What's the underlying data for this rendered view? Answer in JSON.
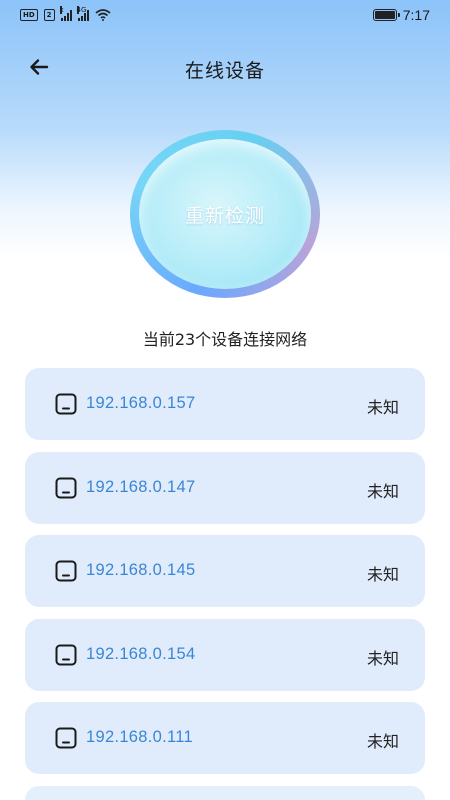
{
  "status_bar": {
    "badge_hd": "HD",
    "badge_2": "2",
    "sig1_label": "x",
    "sig2_label": "4G",
    "time": "7:17"
  },
  "header": {
    "title": "在线设备"
  },
  "scan": {
    "button_label": "重新检测"
  },
  "summary": {
    "text": "当前23个设备连接网络"
  },
  "devices": [
    {
      "ip": "192.168.0.157",
      "status": "未知"
    },
    {
      "ip": "192.168.0.147",
      "status": "未知"
    },
    {
      "ip": "192.168.0.145",
      "status": "未知"
    },
    {
      "ip": "192.168.0.154",
      "status": "未知"
    },
    {
      "ip": "192.168.0.111",
      "status": "未知"
    }
  ],
  "colors": {
    "accent": "#3a86d4",
    "card": "#e0ecfc",
    "header_gradient_top": "#8cc3f9"
  },
  "icons": {
    "back": "arrow-left-icon",
    "device": "device-square-icon",
    "wifi": "wifi-icon",
    "battery": "battery-icon"
  }
}
